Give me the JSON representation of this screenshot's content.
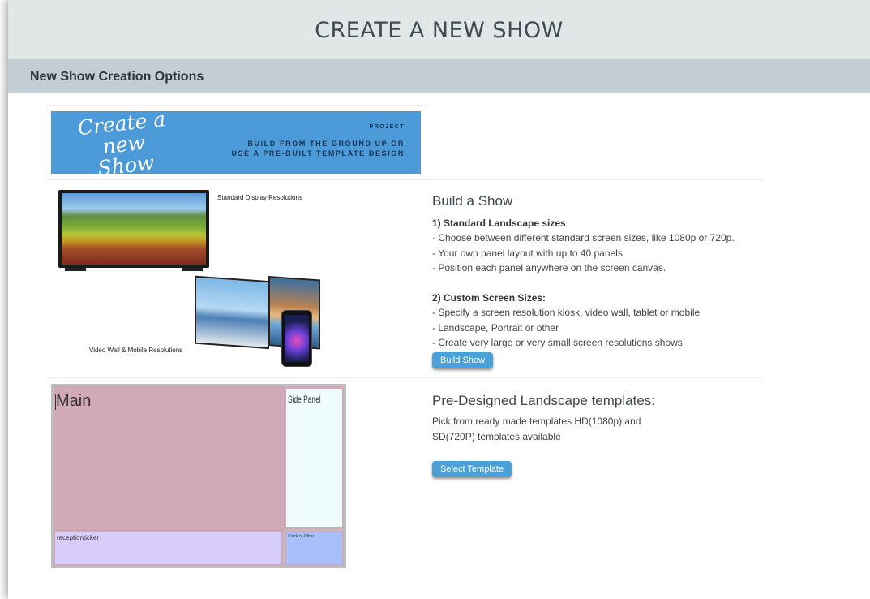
{
  "header": {
    "title": "CREATE A NEW SHOW"
  },
  "section": {
    "title": "New Show Creation Options"
  },
  "banner": {
    "script_text": "Create a new Show",
    "project_label": "PROJECT",
    "line1": "BUILD FROM THE GROUND UP  OR",
    "line2": "USE A PRE-BUILT TEMPLATE DESIGN"
  },
  "build": {
    "illustration": {
      "standard_caption": "Standard Display Resolutions",
      "wall_caption": "Video Wall & Mobile Resolutions"
    },
    "heading": "Build a Show",
    "standard": {
      "title": "1) Standard Landscape sizes",
      "items": [
        "- Choose between different standard screen sizes, like 1080p or 720p.",
        "- Your own panel layout with up to 40 panels",
        "- Position each panel anywhere on the screen canvas."
      ]
    },
    "custom": {
      "title": "2) Custom Screen Sizes:",
      "items": [
        "- Specify a screen resolution kiosk, video wall, tablet or mobile",
        "- Landscape, Portrait or other",
        "- Create very large or very small screen resolutions shows"
      ]
    },
    "button_label": "Build Show"
  },
  "templates": {
    "heading": "Pre-Designed Landscape templates:",
    "description_line1": "Pick from ready made templates HD(1080p) and",
    "description_line2": "SD(720P) templates available",
    "button_label": "Select Template",
    "preview": {
      "main_label": "Main",
      "side_label": "Side Panel",
      "ticker_label": "receptionticker",
      "clock_label": "Clock or Other"
    }
  },
  "colors": {
    "accent": "#4ba0d6",
    "header_bg": "#e1e6e7",
    "section_bg": "#c2ced3",
    "banner_bg": "#4c9ad8"
  }
}
